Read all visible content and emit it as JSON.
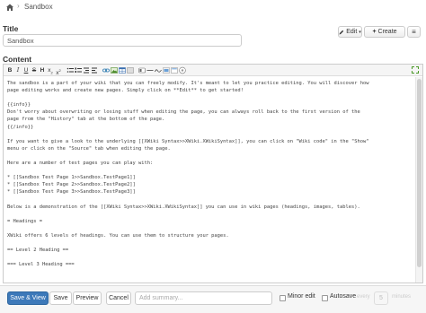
{
  "breadcrumb": {
    "separator": "›",
    "current": "Sandbox"
  },
  "title_field": {
    "label": "Title",
    "value": "Sandbox"
  },
  "actions": {
    "edit_label": "Edit",
    "edit_caret": "▾",
    "create_label": "Create",
    "create_plus": "+",
    "more_label": "≡"
  },
  "content": {
    "label": "Content"
  },
  "toolbar": {
    "bold": "B",
    "italic": "I",
    "underline": "U",
    "strikethrough": "S",
    "h1": "H",
    "sub": "x",
    "sup": "x",
    "icons": [
      "bullet-list-icon",
      "numbered-list-icon",
      "link-icon",
      "image-icon",
      "table-icon",
      "code-icon",
      "macro-icon",
      "horizontal-line-icon",
      "signature-icon",
      "separator-icon",
      "find-icon",
      "help-icon"
    ]
  },
  "editor_text": "The sandbox is a part of your wiki that you can freely modify. It's meant to let you practice editing. You will discover how\npage editing works and create new pages. Simply click on **Edit** to get started!\n\n{{info}}\nDon't worry about overwriting or losing stuff when editing the page, you can always roll back to the first version of the\npage from the \"History\" tab at the bottom of the page.\n{{/info}}\n\nIf you want to give a look to the underlying [[XWiki Syntax>>XWiki.XWikiSyntax]], you can click on \"Wiki code\" in the \"Show\"\nmenu or click on the \"Source\" tab when editing the page.\n\nHere are a number of test pages you can play with:\n\n* [[Sandbox Test Page 1>>Sandbox.TestPage1]]\n* [[Sandbox Test Page 2>>Sandbox.TestPage2]]\n* [[Sandbox Test Page 3>>Sandbox.TestPage3]]\n\nBelow is a demonstration of the [[XWiki Syntax>>XWiki.XWikiSyntax]] you can use in wiki pages (headings, images, tables).\n\n= Headings =\n\nXWiki offers 6 levels of headings. You can use them to structure your pages.\n\n== Level 2 Heading ==\n\n=== Level 3 Heading ===",
  "bottom": {
    "save_view": "Save & View",
    "save": "Save",
    "preview": "Preview",
    "cancel": "Cancel",
    "summary_placeholder": "Add summary...",
    "minor_edit": "Minor edit",
    "autosave": "Autosave",
    "every": "every",
    "minutes_value": "5",
    "minutes": "minutes"
  },
  "colors": {
    "primary_button": "#3d79b9",
    "toolbar_bg": "#f5f5f5",
    "border": "#cccccc"
  }
}
